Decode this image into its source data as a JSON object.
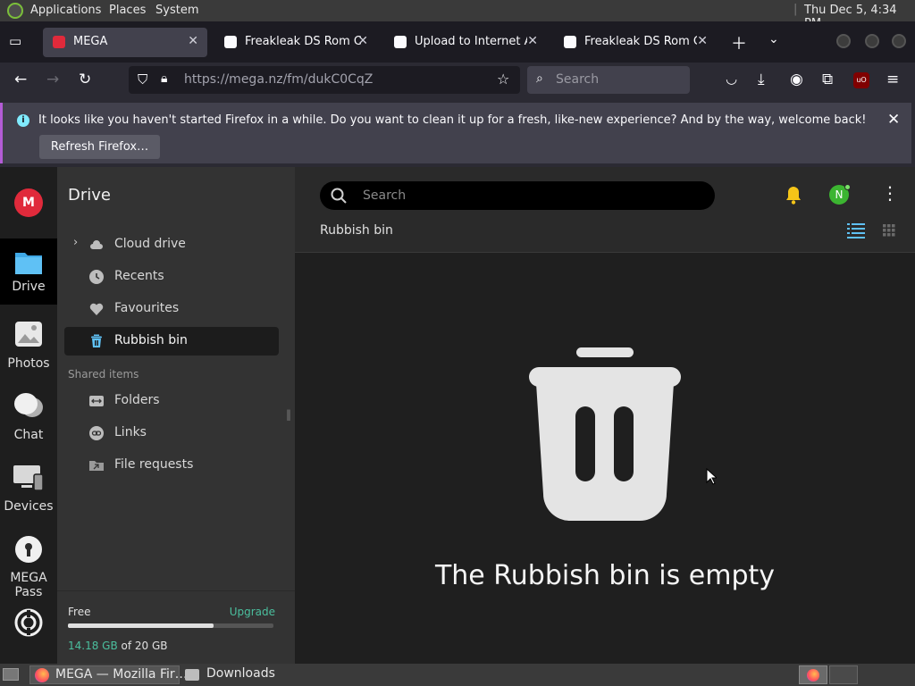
{
  "os_panel": {
    "menus": [
      "Applications",
      "Places",
      "System"
    ],
    "clock": "Thu Dec  5,  4:34 PM"
  },
  "tabs": [
    {
      "title": "MEGA",
      "active": true
    },
    {
      "title": "Freakleak DS Rom Col",
      "active": false
    },
    {
      "title": "Upload to Internet Arc",
      "active": false
    },
    {
      "title": "Freakleak DS Rom Col",
      "active": false
    }
  ],
  "navbar": {
    "url": "https://mega.nz/fm/dukC0CqZ",
    "search_placeholder": "Search"
  },
  "notification": {
    "message": "It looks like you haven't started Firefox in a while. Do you want to clean it up for a fresh, like-new experience? And by the way, welcome back!",
    "button": "Refresh Firefox…"
  },
  "rail": {
    "logo": "M",
    "items": [
      {
        "label": "Drive",
        "icon": "folder-icon",
        "active": true
      },
      {
        "label": "Photos",
        "icon": "photos-icon",
        "active": false
      },
      {
        "label": "Chat",
        "icon": "chat-icon",
        "active": false
      },
      {
        "label": "Devices",
        "icon": "devices-icon",
        "active": false
      },
      {
        "label": "MEGA",
        "label2": "Pass",
        "icon": "pass-icon",
        "active": false
      }
    ]
  },
  "sidebar": {
    "title": "Drive",
    "items": [
      {
        "label": "Cloud drive",
        "icon": "cloud-icon"
      },
      {
        "label": "Recents",
        "icon": "clock-icon"
      },
      {
        "label": "Favourites",
        "icon": "heart-icon"
      },
      {
        "label": "Rubbish bin",
        "icon": "trash-icon",
        "active": true
      }
    ],
    "shared_label": "Shared items",
    "shared_items": [
      {
        "label": "Folders",
        "icon": "shared-folder-icon"
      },
      {
        "label": "Links",
        "icon": "link-icon"
      },
      {
        "label": "File requests",
        "icon": "file-request-icon"
      }
    ],
    "storage": {
      "free_label": "Free",
      "upgrade_label": "Upgrade",
      "used": "14.18 GB",
      "of_total": " of 20 GB",
      "used_fraction": 0.709
    }
  },
  "main": {
    "search_placeholder": "Search",
    "breadcrumb": "Rubbish bin",
    "avatar_letter": "N",
    "empty_message": "The Rubbish bin is empty"
  },
  "taskbar": {
    "items": [
      "MEGA — Mozilla Fir…",
      "Downloads"
    ]
  },
  "colors": {
    "mega_red": "#e02a3b",
    "accent_teal": "#4bbf9e",
    "avatar_green": "#3cb531",
    "bell_yellow": "#f5c518"
  }
}
